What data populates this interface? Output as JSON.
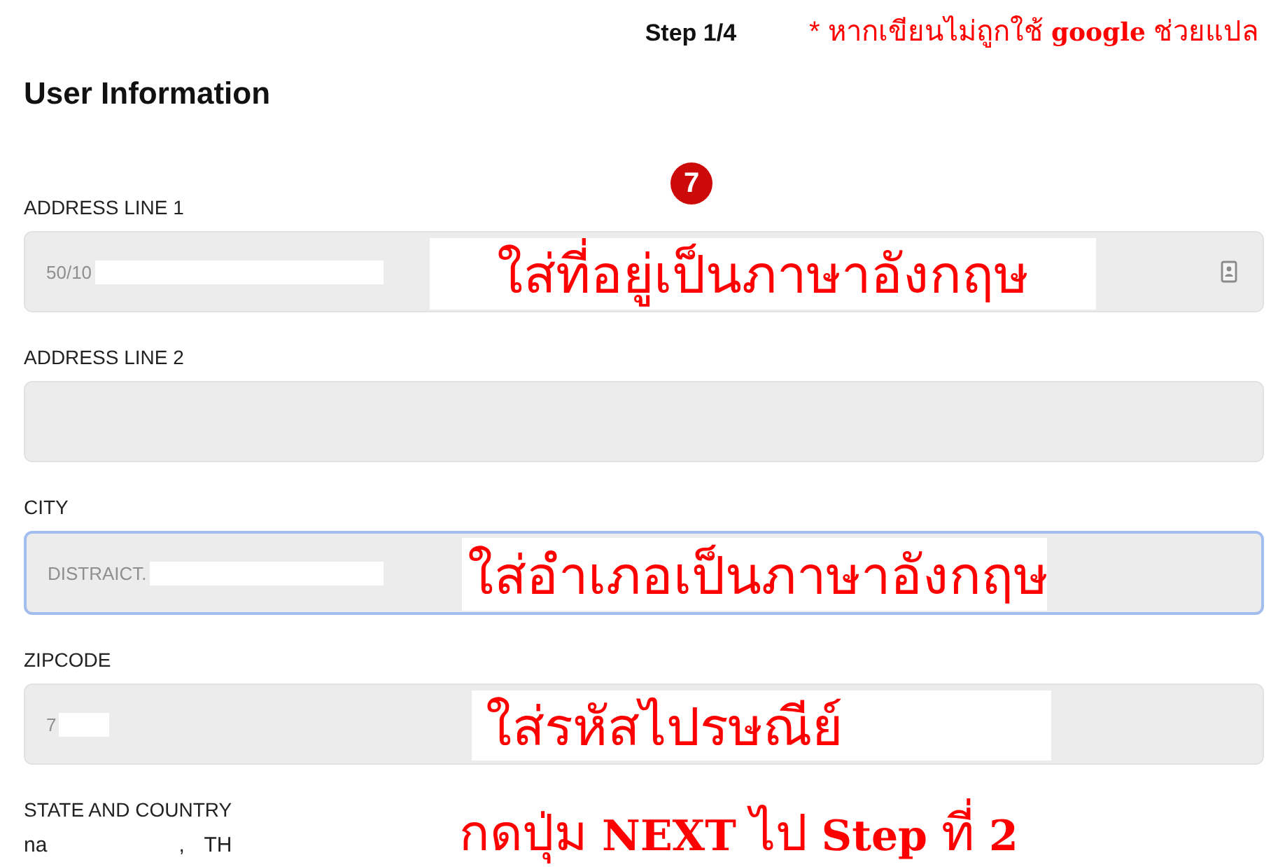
{
  "header": {
    "step": "Step 1/4",
    "note": "* หากเขียนไม่ถูกใช้ **google** ช่วยแปล"
  },
  "title": "User Information",
  "marker": "7",
  "fields": [
    {
      "label": "ADDRESS LINE 1",
      "value": "50/10",
      "redacted": true,
      "focused": false,
      "contact_icon": true,
      "annotation": "ใส่ที่อยู่เป็นภาษาอังกฤษ"
    },
    {
      "label": "ADDRESS LINE 2",
      "redacted": false,
      "focused": false,
      "contact_icon": false
    },
    {
      "label": "CITY",
      "value": "DISTRAICT.",
      "redacted": true,
      "focused": true,
      "contact_icon": false,
      "annotation": "ใส่อำเภอเป็นภาษาอังกฤษ"
    },
    {
      "label": "ZIPCODE",
      "value": "7",
      "redacted": true,
      "focused": false,
      "contact_icon": false,
      "annotation": "ใส่รหัสไปรษณีย์"
    }
  ],
  "state_country": {
    "label": "STATE AND COUNTRY",
    "value_start": "na",
    "value_end": ", TH"
  },
  "footer_note": "กดปุ่ม **NEXT** ไป **Step** ที่ **2**"
}
